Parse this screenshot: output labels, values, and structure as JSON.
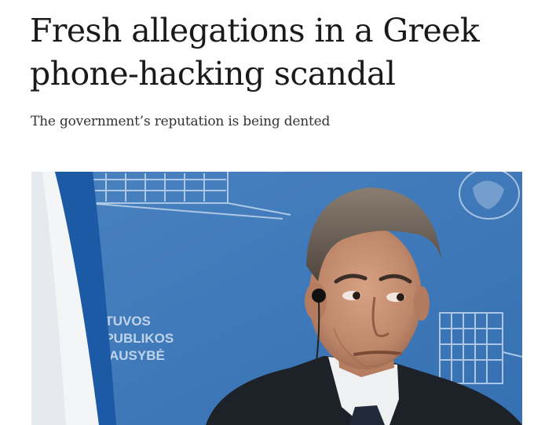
{
  "article": {
    "headline": "Fresh allegations in a Greek phone-hacking scandal",
    "standfirst": "The government’s reputation is being dented"
  },
  "photo": {
    "backdrop_text": [
      "ETUVOS",
      "SPUBLIKOS",
      "RIAUSYBĖ"
    ],
    "colors": {
      "backdrop": "#3f78b8",
      "flag_blue": "#1d5aa6",
      "flag_white": "#f4f5f7"
    }
  }
}
